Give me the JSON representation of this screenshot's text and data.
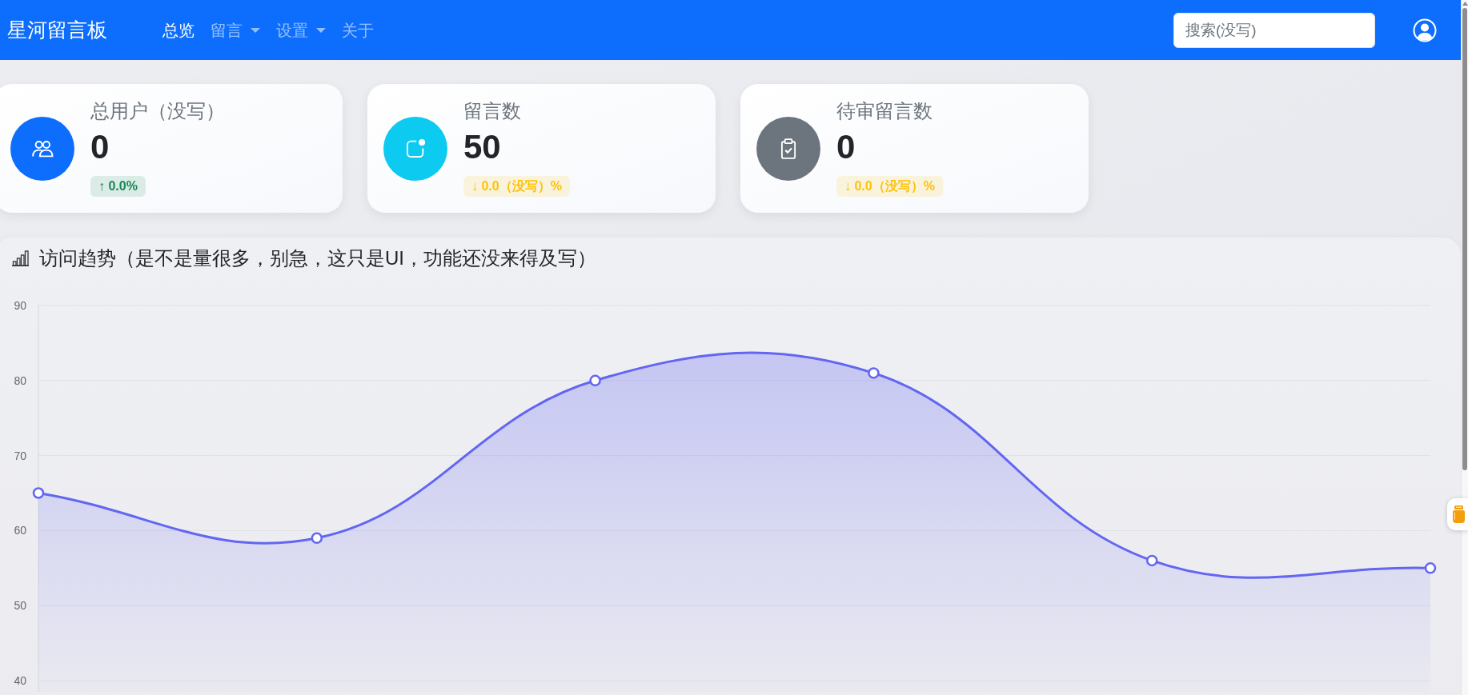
{
  "navbar": {
    "brand": "星河留言板",
    "items": [
      {
        "label": "总览",
        "kind": "link",
        "selected": true
      },
      {
        "label": "留言",
        "kind": "dropdown",
        "selected": false
      },
      {
        "label": "设置",
        "kind": "dropdown",
        "selected": false
      },
      {
        "label": "关于",
        "kind": "link",
        "selected": false
      }
    ],
    "search": {
      "placeholder": "搜索(没写)"
    }
  },
  "stats": [
    {
      "title": "总用户（没写）",
      "value": "0",
      "color": "#0d6efd",
      "change": {
        "text": "↑ 0.0%",
        "color": "#198754"
      }
    },
    {
      "title": "留言数",
      "value": "50",
      "color": "#0dcaf0",
      "change": {
        "text": "↓ 0.0（没写）%",
        "color": "#ffc107"
      }
    },
    {
      "title": "待审留言数",
      "value": "0",
      "color": "#6c757d",
      "change": {
        "text": "↓ 0.0（没写）%",
        "color": "#ffc107"
      }
    }
  ],
  "chart_card": {
    "title": "访问趋势（是不是量很多，别急，这只是UI，功能还没来得及写）",
    "chart_data": {
      "type": "area",
      "grid": true,
      "ylim": [
        40,
        90
      ],
      "yticks": [
        40,
        50,
        60,
        70,
        80,
        90
      ],
      "series": [
        {
          "color": "#6366f1",
          "values": [
            65,
            59,
            80,
            81,
            56,
            55
          ]
        }
      ]
    }
  }
}
